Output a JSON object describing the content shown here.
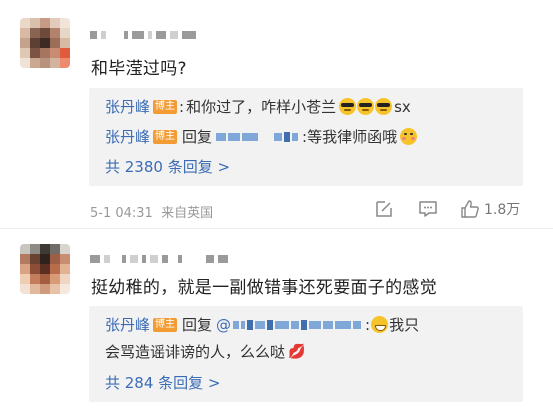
{
  "comments": [
    {
      "text": "和毕滢过吗?",
      "replies": [
        {
          "author": "张丹峰",
          "badge": "博主",
          "sep": ":",
          "text": "和你过了，咋样小苍兰",
          "tail": "sx"
        },
        {
          "author": "张丹峰",
          "badge": "博主",
          "reply_word": "回复",
          "text": ":等我律师函哦"
        }
      ],
      "more_replies": "共 2380 条回复 >",
      "meta": "5-1 04:31  来自英国",
      "like_count": "1.8万"
    },
    {
      "text": "挺幼稚的，就是一副做错事还死要面子的感觉",
      "replies": [
        {
          "author": "张丹峰",
          "badge": "博主",
          "reply_word": "回复",
          "at": "@",
          "text_line1": ":",
          "text_line1_tail": "我只",
          "text_line2": "会骂造谣诽谤的人，么么哒"
        }
      ],
      "more_replies": "共 284 条回复 >"
    }
  ],
  "icons": {
    "edit": "edit-icon",
    "comment": "comment-icon",
    "like": "thumbs-up-icon",
    "emoji_cool": "sunglasses-emoji",
    "emoji_blush": "blush-emoji",
    "emoji_grin": "grin-emoji",
    "emoji_lips": "lips-emoji"
  },
  "colors": {
    "link": "#3b6cb5",
    "badge": "#f39c34",
    "reply_bg": "#f2f2f2"
  }
}
